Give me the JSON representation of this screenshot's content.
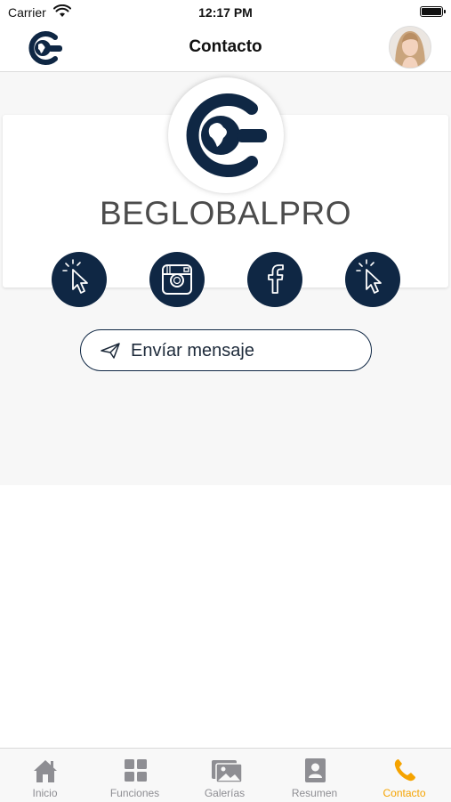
{
  "status_bar": {
    "carrier": "Carrier",
    "time": "12:17 PM"
  },
  "header": {
    "title": "Contacto"
  },
  "profile": {
    "name": "BEGLOBALPRO"
  },
  "social_links": [
    {
      "name": "website",
      "icon": "cursor-click-icon"
    },
    {
      "name": "instagram",
      "icon": "instagram-icon"
    },
    {
      "name": "facebook",
      "icon": "facebook-icon"
    },
    {
      "name": "link",
      "icon": "cursor-click-icon"
    }
  ],
  "message_button": {
    "label": "Envíar mensaje",
    "icon": "paper-plane-icon"
  },
  "tabs": [
    {
      "label": "Inicio",
      "icon": "home-icon"
    },
    {
      "label": "Funciones",
      "icon": "grid-icon"
    },
    {
      "label": "Galerías",
      "icon": "gallery-icon"
    },
    {
      "label": "Resumen",
      "icon": "profile-card-icon"
    },
    {
      "label": "Contacto",
      "icon": "phone-icon",
      "active": true
    }
  ],
  "colors": {
    "brand": "#0f2744",
    "active_tab": "#f5a300",
    "inactive_tab": "#8e8e93"
  }
}
